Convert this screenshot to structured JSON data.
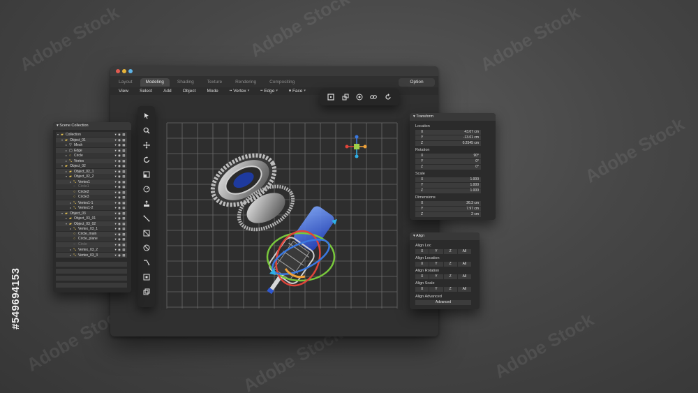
{
  "window": {
    "tabs": [
      {
        "label": "Layout",
        "active": false
      },
      {
        "label": "Modeling",
        "active": true
      },
      {
        "label": "Shading",
        "active": false
      },
      {
        "label": "Texture",
        "active": false
      },
      {
        "label": "Rendering",
        "active": false
      },
      {
        "label": "Compositing",
        "active": false
      }
    ],
    "option_label": "Option",
    "menu": {
      "view": "View",
      "select": "Select",
      "add": "Add",
      "object": "Object",
      "mode": "Mode",
      "vertex": "Vertex",
      "edge": "Edge",
      "face": "Face"
    },
    "traffic_colors": [
      "#e25b50",
      "#e6b43a",
      "#5fb3e6"
    ]
  },
  "top_toolbar_icons": [
    "frame-select-icon",
    "duplicate-icon",
    "add-circle-icon",
    "link-icon",
    "refresh-icon"
  ],
  "side_toolbar_icons": [
    "cursor-icon",
    "search-icon",
    "move-icon",
    "rotate-icon",
    "scale-icon",
    "snap-icon",
    "extrude-icon",
    "knife-icon",
    "slice-icon",
    "measure-icon",
    "shear-icon",
    "transform-icon",
    "select-box-icon"
  ],
  "outliner": {
    "title": "Scene Collection",
    "rows": [
      {
        "label": "Collection",
        "icon": "folder",
        "depth": 0,
        "arrow": "▾",
        "dim": false
      },
      {
        "label": "Object_01",
        "icon": "folder",
        "depth": 1,
        "arrow": "▾",
        "dim": false
      },
      {
        "label": "Mesh",
        "icon": "mesh",
        "depth": 2,
        "arrow": "▸",
        "dim": false
      },
      {
        "label": "Edge",
        "icon": "edge",
        "depth": 2,
        "arrow": "▸",
        "dim": false
      },
      {
        "label": "Circle",
        "icon": "circle",
        "depth": 2,
        "arrow": "▸",
        "dim": false
      },
      {
        "label": "Vertex",
        "icon": "vertex",
        "depth": 2,
        "arrow": "▸",
        "dim": false
      },
      {
        "label": "Object_02",
        "icon": "folder",
        "depth": 1,
        "arrow": "▾",
        "dim": false
      },
      {
        "label": "Object_02_1",
        "icon": "folder",
        "depth": 2,
        "arrow": "▸",
        "dim": false
      },
      {
        "label": "Object_02_2",
        "icon": "folder",
        "depth": 2,
        "arrow": "▾",
        "dim": false
      },
      {
        "label": "Vertex1",
        "icon": "vertex",
        "depth": 3,
        "arrow": "▸",
        "dim": false
      },
      {
        "label": "Circle1",
        "icon": "circle",
        "depth": 3,
        "arrow": "",
        "dim": true
      },
      {
        "label": "Circle2",
        "icon": "circle",
        "depth": 3,
        "arrow": "",
        "dim": false
      },
      {
        "label": "Circle3",
        "icon": "circle",
        "depth": 3,
        "arrow": "",
        "dim": false
      },
      {
        "label": "Vertex1-1",
        "icon": "vertex",
        "depth": 3,
        "arrow": "▸",
        "dim": false
      },
      {
        "label": "Vertex1-2",
        "icon": "vertex",
        "depth": 3,
        "arrow": "▸",
        "dim": false
      },
      {
        "label": "Object_03",
        "icon": "folder",
        "depth": 1,
        "arrow": "▾",
        "dim": false
      },
      {
        "label": "Object_03_01",
        "icon": "folder",
        "depth": 2,
        "arrow": "▸",
        "dim": false
      },
      {
        "label": "Object_03_02",
        "icon": "folder",
        "depth": 2,
        "arrow": "▾",
        "dim": false
      },
      {
        "label": "Vertex_03_1",
        "icon": "vertex",
        "depth": 3,
        "arrow": "▸",
        "dim": false
      },
      {
        "label": "Circle_main",
        "icon": "circle",
        "depth": 3,
        "arrow": "",
        "dim": false
      },
      {
        "label": "Circle_plane",
        "icon": "circle",
        "depth": 3,
        "arrow": "",
        "dim": false
      },
      {
        "label": "Circle",
        "icon": "circle",
        "depth": 3,
        "arrow": "",
        "dim": true
      },
      {
        "label": "Vertex_03_2",
        "icon": "vertex",
        "depth": 3,
        "arrow": "▸",
        "dim": false
      },
      {
        "label": "Vertex_03_3",
        "icon": "vertex",
        "depth": 3,
        "arrow": "▸",
        "dim": false
      }
    ]
  },
  "transform": {
    "title": "Transform",
    "location_label": "Location",
    "location": [
      {
        "axis": "X",
        "value": "43.07 cm"
      },
      {
        "axis": "Y",
        "value": "-13.01 cm"
      },
      {
        "axis": "Z",
        "value": "0.2545 cm"
      }
    ],
    "rotation_label": "Rotation",
    "rotation": [
      {
        "axis": "X",
        "value": "90°"
      },
      {
        "axis": "Y",
        "value": "0°"
      },
      {
        "axis": "Z",
        "value": "0°"
      }
    ],
    "scale_label": "Scale",
    "scale": [
      {
        "axis": "X",
        "value": "1.000"
      },
      {
        "axis": "Y",
        "value": "1.000"
      },
      {
        "axis": "Z",
        "value": "1.000"
      }
    ],
    "dimensions_label": "Dimensions",
    "dimensions": [
      {
        "axis": "X",
        "value": "26.3 cm"
      },
      {
        "axis": "Y",
        "value": "7.97 cm"
      },
      {
        "axis": "Z",
        "value": "2 cm"
      }
    ]
  },
  "align": {
    "title": "Align",
    "sections": [
      {
        "label": "Align Loc",
        "buttons": [
          "X",
          "Y",
          "Z",
          "All"
        ]
      },
      {
        "label": "Align Location",
        "buttons": [
          "X",
          "Y",
          "Z",
          "All"
        ]
      },
      {
        "label": "Align Rotation",
        "buttons": [
          "X",
          "Y",
          "Z",
          "All"
        ]
      },
      {
        "label": "Align Scale",
        "buttons": [
          "X",
          "Y",
          "Z",
          "All"
        ]
      }
    ],
    "advanced_label": "Align Advanced",
    "advanced_button": "Advanced"
  },
  "watermark": {
    "text": "Adobe Stock",
    "id_text": "#549694153"
  },
  "colors": {
    "accent_blue": "#3a78e0",
    "gizmo_red": "#e0443a",
    "gizmo_green": "#79c83c",
    "gizmo_orange": "#f0a23a"
  }
}
